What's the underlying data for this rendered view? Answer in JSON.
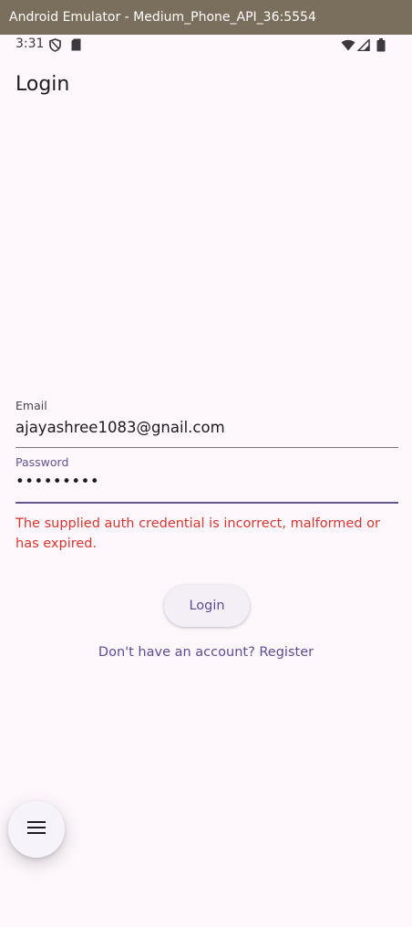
{
  "window": {
    "title": "Android Emulator - Medium_Phone_API_36:5554"
  },
  "statusbar": {
    "time": "3:31",
    "icons": [
      "shield-icon",
      "sd-card-icon",
      "wifi-icon",
      "signal-icon",
      "battery-icon"
    ]
  },
  "appbar": {
    "title": "Login"
  },
  "form": {
    "email_label": "Email",
    "email_value": "ajayashree1083@gnail.com",
    "password_label": "Password",
    "password_value": "•••••••••",
    "error_message": "The supplied auth credential is incorrect, malformed or has expired."
  },
  "actions": {
    "login_label": "Login",
    "register_link": "Don't have an account? Register"
  },
  "fab": {
    "icon": "menu-icon"
  },
  "colors": {
    "background": "#fdf7fc",
    "primary": "#5f4c92",
    "error": "#d9362e",
    "titlebar": "#7a6e5c"
  }
}
